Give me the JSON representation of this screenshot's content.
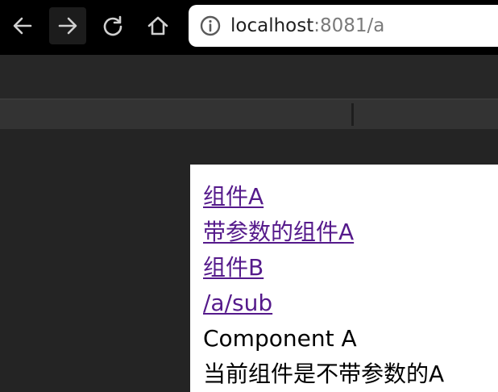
{
  "browser": {
    "url_host": "localhost",
    "url_path": ":8081/a",
    "icons": {
      "back": "arrow-left-icon",
      "forward": "arrow-right-icon",
      "reload": "reload-icon",
      "home": "home-icon",
      "site_info": "info-circle-icon"
    }
  },
  "page": {
    "links": [
      {
        "label": "组件A"
      },
      {
        "label": "带参数的组件A"
      },
      {
        "label": "组件B"
      },
      {
        "label": "/a/sub"
      }
    ],
    "component_text": "Component A",
    "status_text": "当前组件是不带参数的A"
  },
  "colors": {
    "visited_link": "#551a8b",
    "toolbar_bg": "#000000",
    "devtools_bg": "#242424"
  }
}
